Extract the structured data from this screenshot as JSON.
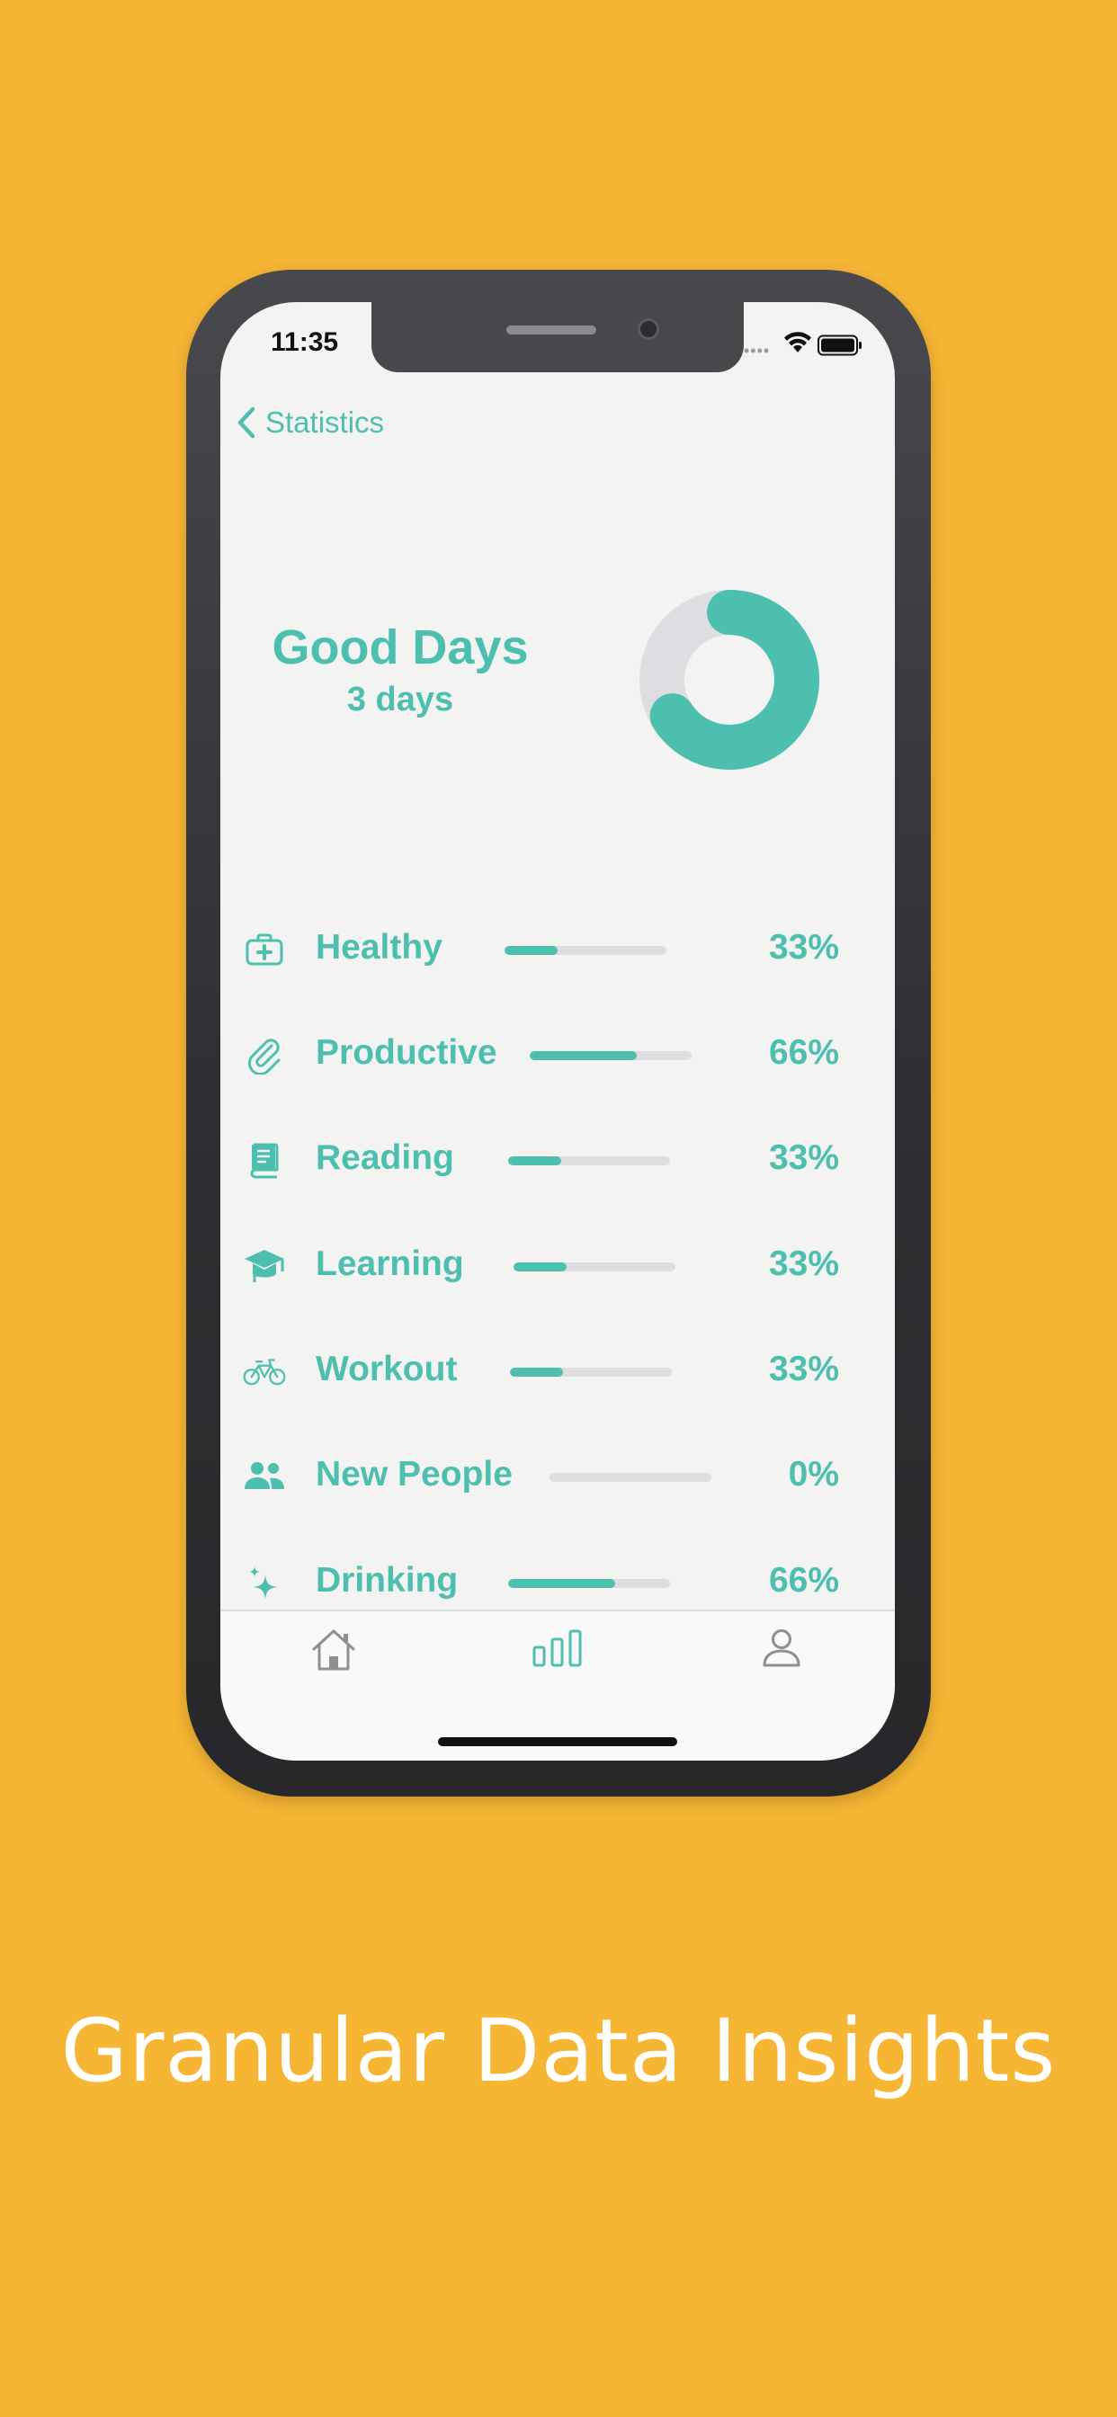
{
  "status_bar": {
    "time": "11:35"
  },
  "nav": {
    "back_label": "Statistics",
    "back_icon": "chevron-left-icon"
  },
  "summary": {
    "title": "Good Days",
    "subtitle": "3 days",
    "good_fraction": 0.66
  },
  "categories": [
    {
      "icon": "first-aid-kit-icon",
      "label": "Healthy",
      "percent_text": "33%",
      "progress": 0.33
    },
    {
      "icon": "paperclip-icon",
      "label": "Productive",
      "percent_text": "66%",
      "progress": 0.66
    },
    {
      "icon": "book-icon",
      "label": "Reading",
      "percent_text": "33%",
      "progress": 0.33
    },
    {
      "icon": "graduation-cap-icon",
      "label": "Learning",
      "percent_text": "33%",
      "progress": 0.33
    },
    {
      "icon": "bicycle-icon",
      "label": "Workout",
      "percent_text": "33%",
      "progress": 0.33
    },
    {
      "icon": "people-icon",
      "label": "New People",
      "percent_text": "0%",
      "progress": 0
    },
    {
      "icon": "sparkles-icon",
      "label": "Drinking",
      "percent_text": "66%",
      "progress": 0.66
    }
  ],
  "tabs": [
    {
      "icon": "home-icon",
      "active": false
    },
    {
      "icon": "bar-chart-icon",
      "active": true
    },
    {
      "icon": "person-icon",
      "active": false
    }
  ],
  "caption": "Granular Data Insights",
  "colors": {
    "background": "#F6B533",
    "accent": "#4DBFAF",
    "track": "#DEDEE2"
  }
}
